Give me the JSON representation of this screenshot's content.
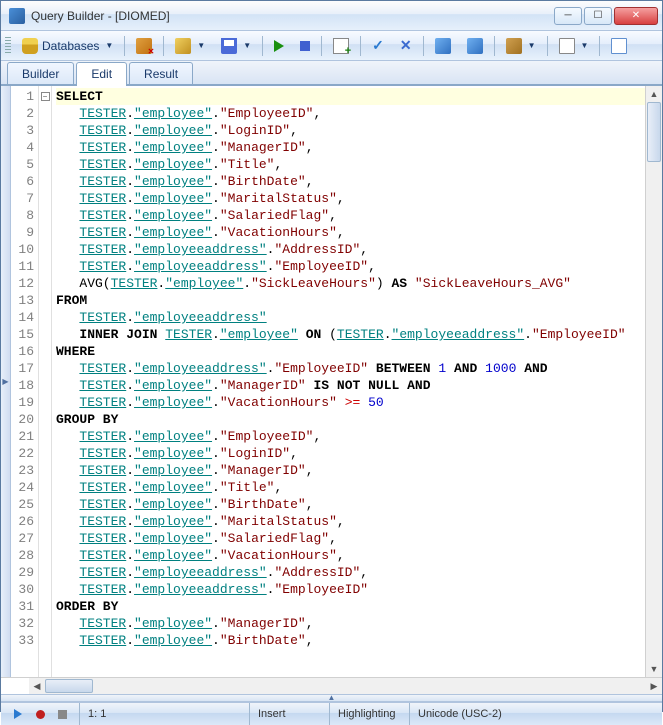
{
  "window": {
    "title": "Query Builder - [DIOMED]"
  },
  "toolbar": {
    "databases": "Databases"
  },
  "tabs": {
    "builder": "Builder",
    "edit": "Edit",
    "result": "Result"
  },
  "code": {
    "lines": [
      {
        "n": 1,
        "t": "select",
        "fold": true
      },
      {
        "n": 2,
        "t": "col",
        "schema": "TESTER",
        "table": "employee",
        "col": "EmployeeID",
        "comma": true,
        "indent": 3
      },
      {
        "n": 3,
        "t": "col",
        "schema": "TESTER",
        "table": "employee",
        "col": "LoginID",
        "comma": true,
        "indent": 3
      },
      {
        "n": 4,
        "t": "col",
        "schema": "TESTER",
        "table": "employee",
        "col": "ManagerID",
        "comma": true,
        "indent": 3
      },
      {
        "n": 5,
        "t": "col",
        "schema": "TESTER",
        "table": "employee",
        "col": "Title",
        "comma": true,
        "indent": 3
      },
      {
        "n": 6,
        "t": "col",
        "schema": "TESTER",
        "table": "employee",
        "col": "BirthDate",
        "comma": true,
        "indent": 3
      },
      {
        "n": 7,
        "t": "col",
        "schema": "TESTER",
        "table": "employee",
        "col": "MaritalStatus",
        "comma": true,
        "indent": 3
      },
      {
        "n": 8,
        "t": "col",
        "schema": "TESTER",
        "table": "employee",
        "col": "SalariedFlag",
        "comma": true,
        "indent": 3
      },
      {
        "n": 9,
        "t": "col",
        "schema": "TESTER",
        "table": "employee",
        "col": "VacationHours",
        "comma": true,
        "indent": 3
      },
      {
        "n": 10,
        "t": "col",
        "schema": "TESTER",
        "table": "employeeaddress",
        "col": "AddressID",
        "comma": true,
        "indent": 3
      },
      {
        "n": 11,
        "t": "col",
        "schema": "TESTER",
        "table": "employeeaddress",
        "col": "EmployeeID",
        "comma": true,
        "indent": 3
      },
      {
        "n": 12,
        "t": "avg",
        "schema": "TESTER",
        "table": "employee",
        "col": "SickLeaveHours",
        "alias": "SickLeaveHours_AVG",
        "indent": 3
      },
      {
        "n": 13,
        "t": "from"
      },
      {
        "n": 14,
        "t": "tblref",
        "schema": "TESTER",
        "table": "employeeaddress",
        "indent": 3
      },
      {
        "n": 15,
        "t": "join",
        "schema": "TESTER",
        "table": "employee",
        "schema2": "TESTER",
        "table2": "employeeaddress",
        "col2": "EmployeeID",
        "indent": 3
      },
      {
        "n": 16,
        "t": "where"
      },
      {
        "n": 17,
        "t": "between",
        "schema": "TESTER",
        "table": "employeeaddress",
        "col": "EmployeeID",
        "lo": 1,
        "hi": 1000,
        "indent": 3
      },
      {
        "n": 18,
        "t": "notnull",
        "schema": "TESTER",
        "table": "employee",
        "col": "ManagerID",
        "indent": 3
      },
      {
        "n": 19,
        "t": "gte",
        "schema": "TESTER",
        "table": "employee",
        "col": "VacationHours",
        "val": 50,
        "indent": 3
      },
      {
        "n": 20,
        "t": "groupby"
      },
      {
        "n": 21,
        "t": "col",
        "schema": "TESTER",
        "table": "employee",
        "col": "EmployeeID",
        "comma": true,
        "indent": 3
      },
      {
        "n": 22,
        "t": "col",
        "schema": "TESTER",
        "table": "employee",
        "col": "LoginID",
        "comma": true,
        "indent": 3
      },
      {
        "n": 23,
        "t": "col",
        "schema": "TESTER",
        "table": "employee",
        "col": "ManagerID",
        "comma": true,
        "indent": 3
      },
      {
        "n": 24,
        "t": "col",
        "schema": "TESTER",
        "table": "employee",
        "col": "Title",
        "comma": true,
        "indent": 3
      },
      {
        "n": 25,
        "t": "col",
        "schema": "TESTER",
        "table": "employee",
        "col": "BirthDate",
        "comma": true,
        "indent": 3
      },
      {
        "n": 26,
        "t": "col",
        "schema": "TESTER",
        "table": "employee",
        "col": "MaritalStatus",
        "comma": true,
        "indent": 3
      },
      {
        "n": 27,
        "t": "col",
        "schema": "TESTER",
        "table": "employee",
        "col": "SalariedFlag",
        "comma": true,
        "indent": 3
      },
      {
        "n": 28,
        "t": "col",
        "schema": "TESTER",
        "table": "employee",
        "col": "VacationHours",
        "comma": true,
        "indent": 3
      },
      {
        "n": 29,
        "t": "col",
        "schema": "TESTER",
        "table": "employeeaddress",
        "col": "AddressID",
        "comma": true,
        "indent": 3
      },
      {
        "n": 30,
        "t": "col",
        "schema": "TESTER",
        "table": "employeeaddress",
        "col": "EmployeeID",
        "comma": false,
        "indent": 3
      },
      {
        "n": 31,
        "t": "orderby"
      },
      {
        "n": 32,
        "t": "col",
        "schema": "TESTER",
        "table": "employee",
        "col": "ManagerID",
        "comma": true,
        "indent": 3
      },
      {
        "n": 33,
        "t": "col",
        "schema": "TESTER",
        "table": "employee",
        "col": "BirthDate",
        "comma": true,
        "indent": 3
      }
    ]
  },
  "status": {
    "pos": "1:   1",
    "insert": "Insert",
    "highlighting": "Highlighting",
    "encoding": "Unicode (USC-2)"
  }
}
